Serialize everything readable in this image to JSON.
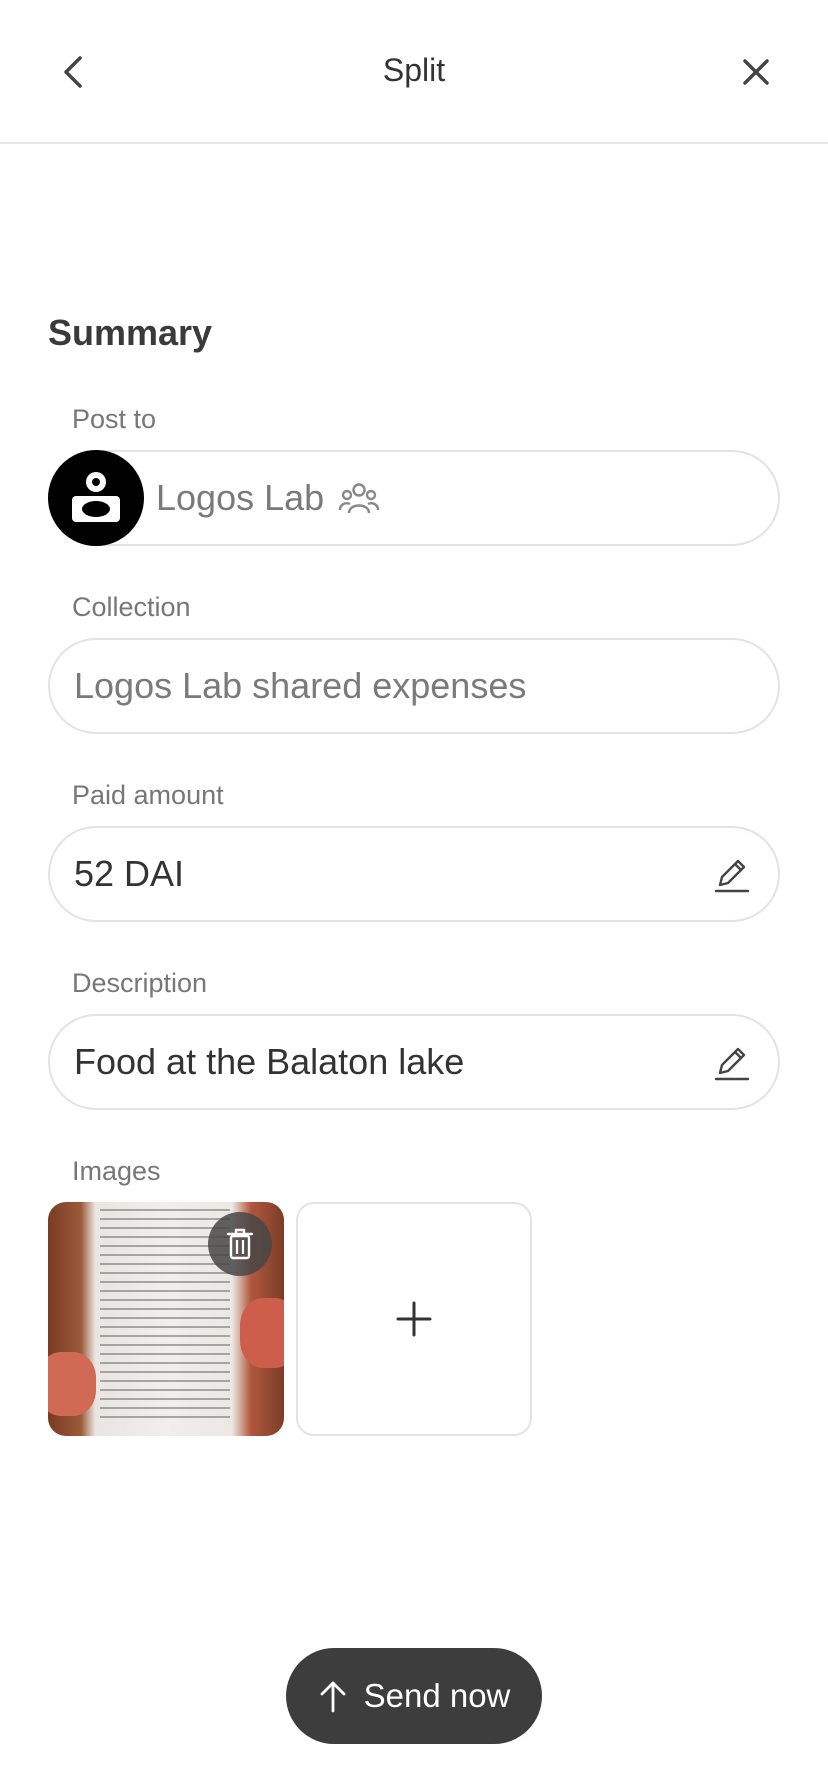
{
  "header": {
    "title": "Split",
    "back_icon": "chevron-left-icon",
    "close_icon": "close-icon"
  },
  "summary": {
    "title": "Summary",
    "post_to": {
      "label": "Post to",
      "value": "Logos Lab",
      "group_icon": "group-icon",
      "avatar": "logos-lab-logo"
    },
    "collection": {
      "label": "Collection",
      "value": "Logos Lab shared expenses"
    },
    "paid_amount": {
      "label": "Paid amount",
      "value": "52 DAI",
      "edit_icon": "pencil-icon"
    },
    "description": {
      "label": "Description",
      "value": "Food at the Balaton lake",
      "edit_icon": "pencil-icon"
    },
    "images": {
      "label": "Images",
      "items": [
        {
          "type": "receipt-photo",
          "delete_icon": "trash-icon"
        }
      ],
      "add_icon": "plus-icon"
    }
  },
  "actions": {
    "send_label": "Send now",
    "send_icon": "arrow-up-icon"
  },
  "colors": {
    "button_bg": "#3d3d3d",
    "border": "#e3e3e3",
    "label": "#777777"
  }
}
